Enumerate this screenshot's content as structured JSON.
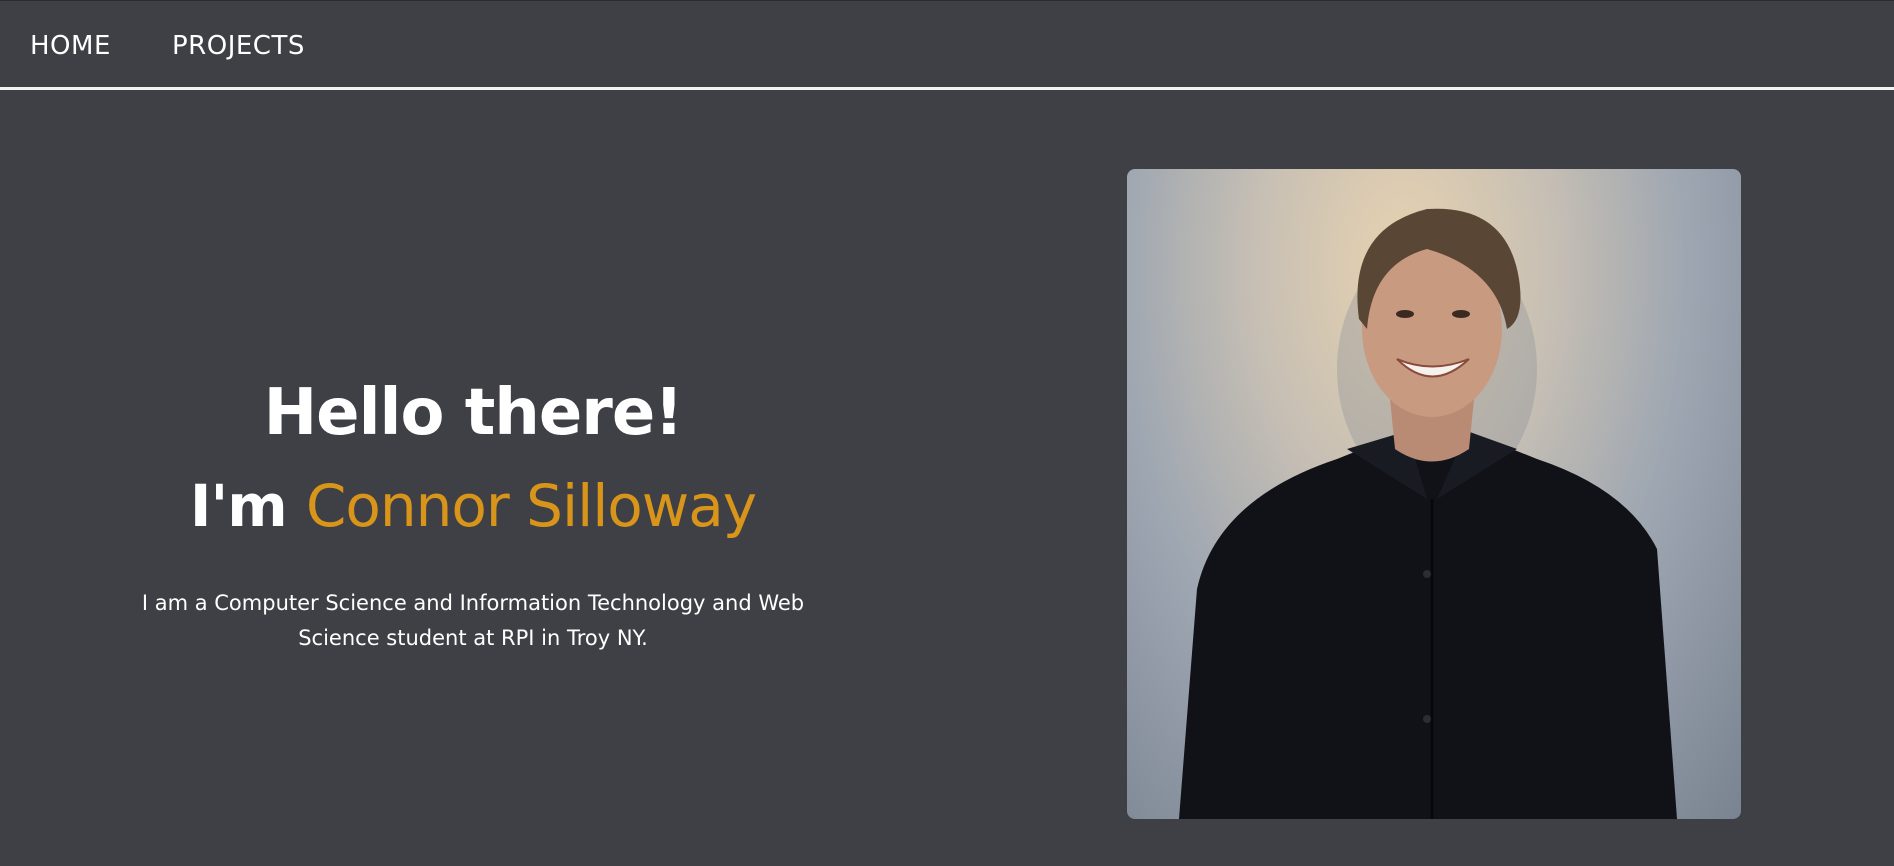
{
  "nav": {
    "home_label": "HOME",
    "projects_label": "PROJECTS"
  },
  "hero": {
    "greeting": "Hello there!",
    "intro_prefix": "I'm",
    "name": "Connor Silloway",
    "bio": "I am a Computer Science and Information Technology and Web Science student at RPI in Troy NY."
  },
  "colors": {
    "background": "#3e4046",
    "accent": "#d8951a",
    "text": "#ffffff",
    "divider": "#f2f2f2"
  }
}
